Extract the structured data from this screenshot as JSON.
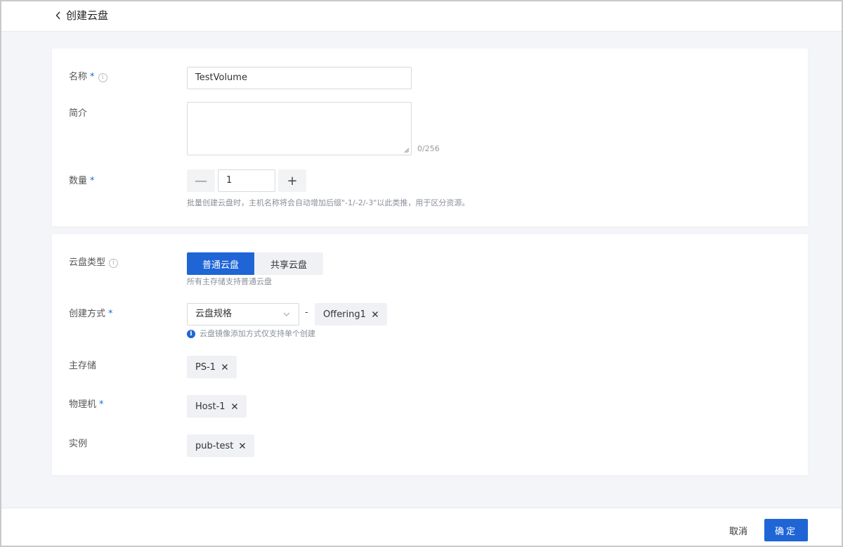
{
  "header": {
    "title": "创建云盘"
  },
  "basic": {
    "name": {
      "label": "名称",
      "required": "*",
      "value": "TestVolume"
    },
    "desc": {
      "label": "简介",
      "value": "",
      "counter": "0/256"
    },
    "quantity": {
      "label": "数量",
      "required": "*",
      "value": "1",
      "minus": "—",
      "plus": "+",
      "hint": "批量创建云盘时，主机名称将会自动增加后缀\"-1/-2/-3\"以此类推，用于区分资源。"
    }
  },
  "config": {
    "disk_type": {
      "label": "云盘类型",
      "options": [
        "普通云盘",
        "共享云盘"
      ],
      "selected": "普通云盘",
      "hint": "所有主存储支持普通云盘"
    },
    "create_mode": {
      "label": "创建方式",
      "required": "*",
      "select_value": "云盘规格",
      "dash": "-",
      "offering_tag": "Offering1",
      "note": "云盘镜像添加方式仅支持单个创建"
    },
    "primary_storage": {
      "label": "主存储",
      "tag": "PS-1"
    },
    "host": {
      "label": "物理机",
      "required": "*",
      "tag": "Host-1"
    },
    "instance": {
      "label": "实例",
      "tag": "pub-test"
    }
  },
  "footer": {
    "cancel_label": "取消",
    "ok_label": "确定"
  },
  "colors": {
    "primary": "#1f65d6",
    "required": "#1a6ae0"
  }
}
